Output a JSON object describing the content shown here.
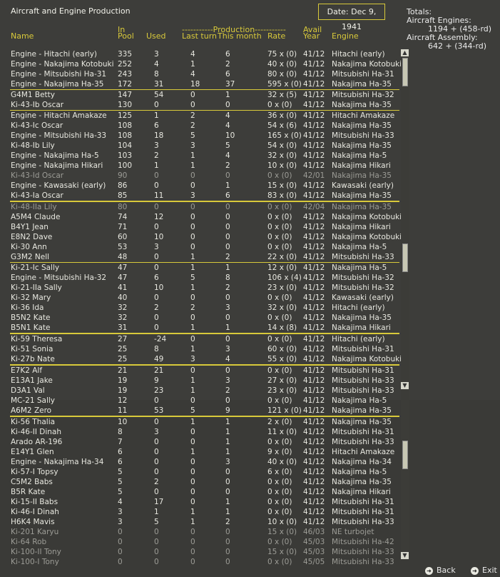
{
  "title": "Aircraft and Engine Production",
  "date": "Date: Dec 9, 1941",
  "totals": {
    "label": "Totals:",
    "engines_label": "Aircraft Engines:",
    "engines_value": "1194 + (458-rd)",
    "assembly_label": "Aircraft Assembly:",
    "assembly_value": "642 + (344-rd)"
  },
  "headers": {
    "name": "Name",
    "in": "In",
    "pool": "Pool",
    "used": "Used",
    "production_group": "-----------Production-----------",
    "last_turn": "Last turn",
    "this_month": "This month",
    "rate": "Rate",
    "avail": "Avail",
    "year": "Year",
    "engine": "Engine"
  },
  "rows": [
    {
      "name": "Engine - Hitachi (early)",
      "pool": "335",
      "used": "3",
      "last": "4",
      "month": "6",
      "rate": "75 x (0)",
      "year": "41/12",
      "engine": "Hitachi (early)"
    },
    {
      "name": "Engine - Nakajima Kotobuki",
      "pool": "252",
      "used": "4",
      "last": "1",
      "month": "2",
      "rate": "40 x (0)",
      "year": "41/12",
      "engine": "Nakajima Kotobuki"
    },
    {
      "name": "Engine - Mitsubishi Ha-31",
      "pool": "243",
      "used": "8",
      "last": "4",
      "month": "6",
      "rate": "80 x (0)",
      "year": "41/12",
      "engine": "Mitsubishi Ha-31"
    },
    {
      "name": "Engine - Nakajima Ha-35",
      "pool": "172",
      "used": "31",
      "last": "18",
      "month": "37",
      "rate": "595 x (0)",
      "year": "41/12",
      "engine": "Nakajima Ha-35"
    },
    {
      "name": "G4M1 Betty",
      "pool": "147",
      "used": "54",
      "last": "0",
      "month": "1",
      "rate": "32 x (5)",
      "year": "41/12",
      "engine": "Mitsubishi Ha-32"
    },
    {
      "name": "Ki-43-Ib Oscar",
      "pool": "130",
      "used": "0",
      "last": "0",
      "month": "0",
      "rate": "0 x (0)",
      "year": "41/12",
      "engine": "Nakajima Ha-35"
    },
    {
      "name": "Engine - Hitachi Amakaze",
      "pool": "125",
      "used": "1",
      "last": "2",
      "month": "4",
      "rate": "36 x (0)",
      "year": "41/12",
      "engine": "Hitachi Amakaze"
    },
    {
      "name": "Ki-43-Ic Oscar",
      "pool": "108",
      "used": "6",
      "last": "2",
      "month": "4",
      "rate": "54 x (6)",
      "year": "41/12",
      "engine": "Nakajima Ha-35"
    },
    {
      "name": "Engine - Mitsubishi Ha-33",
      "pool": "108",
      "used": "18",
      "last": "5",
      "month": "10",
      "rate": "165 x (0)",
      "year": "41/12",
      "engine": "Mitsubishi Ha-33"
    },
    {
      "name": "Ki-48-Ib Lily",
      "pool": "104",
      "used": "3",
      "last": "3",
      "month": "5",
      "rate": "54 x (0)",
      "year": "41/12",
      "engine": "Nakajima Ha-35"
    },
    {
      "name": "Engine - Nakajima Ha-5",
      "pool": "103",
      "used": "2",
      "last": "1",
      "month": "4",
      "rate": "32 x (0)",
      "year": "41/12",
      "engine": "Nakajima Ha-5"
    },
    {
      "name": "Engine - Nakajima Hikari",
      "pool": "100",
      "used": "1",
      "last": "1",
      "month": "2",
      "rate": "10 x (0)",
      "year": "41/12",
      "engine": "Nakajima Hikari"
    },
    {
      "name": "Ki-43-Id Oscar",
      "pool": "90",
      "used": "0",
      "last": "0",
      "month": "0",
      "rate": "0 x (0)",
      "year": "42/01",
      "engine": "Nakajima Ha-35",
      "gray": true
    },
    {
      "name": "Engine - Kawasaki (early)",
      "pool": "86",
      "used": "0",
      "last": "0",
      "month": "1",
      "rate": "15 x (0)",
      "year": "41/12",
      "engine": "Kawasaki (early)"
    },
    {
      "name": "Ki-43-Ia Oscar",
      "pool": "85",
      "used": "11",
      "last": "3",
      "month": "6",
      "rate": "83 x (0)",
      "year": "41/12",
      "engine": "Nakajima Ha-35"
    },
    {
      "name": "Ki-48-IIa Lily",
      "pool": "80",
      "used": "0",
      "last": "0",
      "month": "0",
      "rate": "0 x (0)",
      "year": "42/04",
      "engine": "Nakajima Ha-35",
      "gray": true
    },
    {
      "name": "A5M4 Claude",
      "pool": "74",
      "used": "12",
      "last": "0",
      "month": "0",
      "rate": "0 x (0)",
      "year": "41/12",
      "engine": "Nakajima Kotobuki"
    },
    {
      "name": "B4Y1 Jean",
      "pool": "71",
      "used": "0",
      "last": "0",
      "month": "0",
      "rate": "0 x (0)",
      "year": "41/12",
      "engine": "Nakajima Hikari"
    },
    {
      "name": "E8N2 Dave",
      "pool": "60",
      "used": "10",
      "last": "0",
      "month": "0",
      "rate": "0 x (0)",
      "year": "41/12",
      "engine": "Nakajima Kotobuki"
    },
    {
      "name": "Ki-30 Ann",
      "pool": "53",
      "used": "3",
      "last": "0",
      "month": "0",
      "rate": "0 x (0)",
      "year": "41/12",
      "engine": "Nakajima Ha-5"
    },
    {
      "name": "G3M2 Nell",
      "pool": "48",
      "used": "0",
      "last": "1",
      "month": "2",
      "rate": "22 x (0)",
      "year": "41/12",
      "engine": "Mitsubishi Ha-33"
    },
    {
      "name": "Ki-21-Ic Sally",
      "pool": "47",
      "used": "0",
      "last": "1",
      "month": "1",
      "rate": "12 x (0)",
      "year": "41/12",
      "engine": "Nakajima Ha-5"
    },
    {
      "name": "Engine - Mitsubishi Ha-32",
      "pool": "47",
      "used": "6",
      "last": "5",
      "month": "8",
      "rate": "106 x (4)",
      "year": "41/12",
      "engine": "Mitsubishi Ha-32"
    },
    {
      "name": "Ki-21-IIa Sally",
      "pool": "41",
      "used": "10",
      "last": "1",
      "month": "2",
      "rate": "23 x (0)",
      "year": "41/12",
      "engine": "Mitsubishi Ha-32"
    },
    {
      "name": "Ki-32 Mary",
      "pool": "40",
      "used": "0",
      "last": "0",
      "month": "0",
      "rate": "0 x (0)",
      "year": "41/12",
      "engine": "Kawasaki (early)"
    },
    {
      "name": "Ki-36 Ida",
      "pool": "32",
      "used": "2",
      "last": "2",
      "month": "3",
      "rate": "32 x (0)",
      "year": "41/12",
      "engine": "Hitachi (early)"
    },
    {
      "name": "B5N2 Kate",
      "pool": "32",
      "used": "0",
      "last": "0",
      "month": "0",
      "rate": "0 x (0)",
      "year": "41/12",
      "engine": "Nakajima Ha-35"
    },
    {
      "name": "B5N1 Kate",
      "pool": "31",
      "used": "0",
      "last": "1",
      "month": "1",
      "rate": "14 x (8)",
      "year": "41/12",
      "engine": "Nakajima Hikari"
    },
    {
      "name": "Ki-59 Theresa",
      "pool": "27",
      "used": "-24",
      "last": "0",
      "month": "0",
      "rate": "0 x (0)",
      "year": "41/12",
      "engine": "Hitachi (early)"
    },
    {
      "name": "Ki-51 Sonia",
      "pool": "25",
      "used": "8",
      "last": "1",
      "month": "3",
      "rate": "60 x (0)",
      "year": "41/12",
      "engine": "Mitsubishi Ha-31"
    },
    {
      "name": "Ki-27b Nate",
      "pool": "25",
      "used": "49",
      "last": "3",
      "month": "4",
      "rate": "55 x (0)",
      "year": "41/12",
      "engine": "Nakajima Kotobuki"
    },
    {
      "name": "E7K2 Alf",
      "pool": "21",
      "used": "21",
      "last": "0",
      "month": "0",
      "rate": "0 x (0)",
      "year": "41/12",
      "engine": "Mitsubishi Ha-31"
    },
    {
      "name": "E13A1 Jake",
      "pool": "19",
      "used": "9",
      "last": "1",
      "month": "3",
      "rate": "27 x (0)",
      "year": "41/12",
      "engine": "Mitsubishi Ha-33"
    },
    {
      "name": "D3A1 Val",
      "pool": "19",
      "used": "23",
      "last": "1",
      "month": "2",
      "rate": "23 x (0)",
      "year": "41/12",
      "engine": "Mitsubishi Ha-33"
    },
    {
      "name": "MC-21 Sally",
      "pool": "12",
      "used": "0",
      "last": "0",
      "month": "0",
      "rate": "0 x (0)",
      "year": "41/12",
      "engine": "Nakajima Ha-5"
    },
    {
      "name": "A6M2 Zero",
      "pool": "11",
      "used": "53",
      "last": "5",
      "month": "9",
      "rate": "121 x (0)",
      "year": "41/12",
      "engine": "Nakajima Ha-35"
    },
    {
      "name": "Ki-56 Thalia",
      "pool": "10",
      "used": "0",
      "last": "1",
      "month": "1",
      "rate": "2 x (0)",
      "year": "41/12",
      "engine": "Nakajima Ha-35"
    },
    {
      "name": "Ki-46-II Dinah",
      "pool": "8",
      "used": "3",
      "last": "0",
      "month": "1",
      "rate": "11 x (0)",
      "year": "41/12",
      "engine": "Mitsubishi Ha-31"
    },
    {
      "name": "Arado AR-196",
      "pool": "7",
      "used": "0",
      "last": "0",
      "month": "1",
      "rate": "0 x (0)",
      "year": "41/12",
      "engine": "Mitsubishi Ha-33"
    },
    {
      "name": "E14Y1 Glen",
      "pool": "6",
      "used": "0",
      "last": "1",
      "month": "1",
      "rate": "9 x (0)",
      "year": "41/12",
      "engine": "Hitachi Amakaze"
    },
    {
      "name": "Engine - Nakajima Ha-34",
      "pool": "6",
      "used": "0",
      "last": "0",
      "month": "3",
      "rate": "40 x (0)",
      "year": "41/12",
      "engine": "Nakajima Ha-34"
    },
    {
      "name": "Ki-57-I Topsy",
      "pool": "5",
      "used": "0",
      "last": "0",
      "month": "0",
      "rate": "6 x (0)",
      "year": "41/12",
      "engine": "Nakajima Ha-5"
    },
    {
      "name": "C5M2 Babs",
      "pool": "5",
      "used": "2",
      "last": "0",
      "month": "0",
      "rate": "0 x (0)",
      "year": "41/12",
      "engine": "Nakajima Ha-35"
    },
    {
      "name": "B5R Kate",
      "pool": "5",
      "used": "0",
      "last": "0",
      "month": "0",
      "rate": "0 x (0)",
      "year": "41/12",
      "engine": "Nakajima Hikari"
    },
    {
      "name": "Ki-15-II Babs",
      "pool": "4",
      "used": "17",
      "last": "0",
      "month": "1",
      "rate": "0 x (0)",
      "year": "41/12",
      "engine": "Mitsubishi Ha-31"
    },
    {
      "name": "Ki-46-I Dinah",
      "pool": "3",
      "used": "1",
      "last": "1",
      "month": "1",
      "rate": "0 x (0)",
      "year": "41/12",
      "engine": "Mitsubishi Ha-31"
    },
    {
      "name": "H6K4 Mavis",
      "pool": "3",
      "used": "5",
      "last": "1",
      "month": "2",
      "rate": "10 x (0)",
      "year": "41/12",
      "engine": "Mitsubishi Ha-33"
    },
    {
      "name": "Ki-201 Karyu",
      "pool": "0",
      "used": "0",
      "last": "0",
      "month": "0",
      "rate": "15 x (0)",
      "year": "46/03",
      "engine": "NE turbojet",
      "gray": true
    },
    {
      "name": "Ki-64 Rob",
      "pool": "0",
      "used": "0",
      "last": "0",
      "month": "0",
      "rate": "0 x (0)",
      "year": "45/03",
      "engine": "Mitsubishi Ha-42",
      "gray": true
    },
    {
      "name": "Ki-100-II Tony",
      "pool": "0",
      "used": "0",
      "last": "0",
      "month": "0",
      "rate": "15 x (0)",
      "year": "45/03",
      "engine": "Mitsubishi Ha-33",
      "gray": true
    },
    {
      "name": "Ki-100-I Tony",
      "pool": "0",
      "used": "0",
      "last": "0",
      "month": "0",
      "rate": "0 x (0)",
      "year": "45/05",
      "engine": "Mitsubishi Ha-33",
      "gray": true
    }
  ],
  "buttons": {
    "back": "Back",
    "exit": "Exit"
  },
  "icons": {
    "up": "arrow-up-icon",
    "down": "arrow-down-icon",
    "back": "back-arrow-icon",
    "exit": "exit-arrow-icon"
  }
}
